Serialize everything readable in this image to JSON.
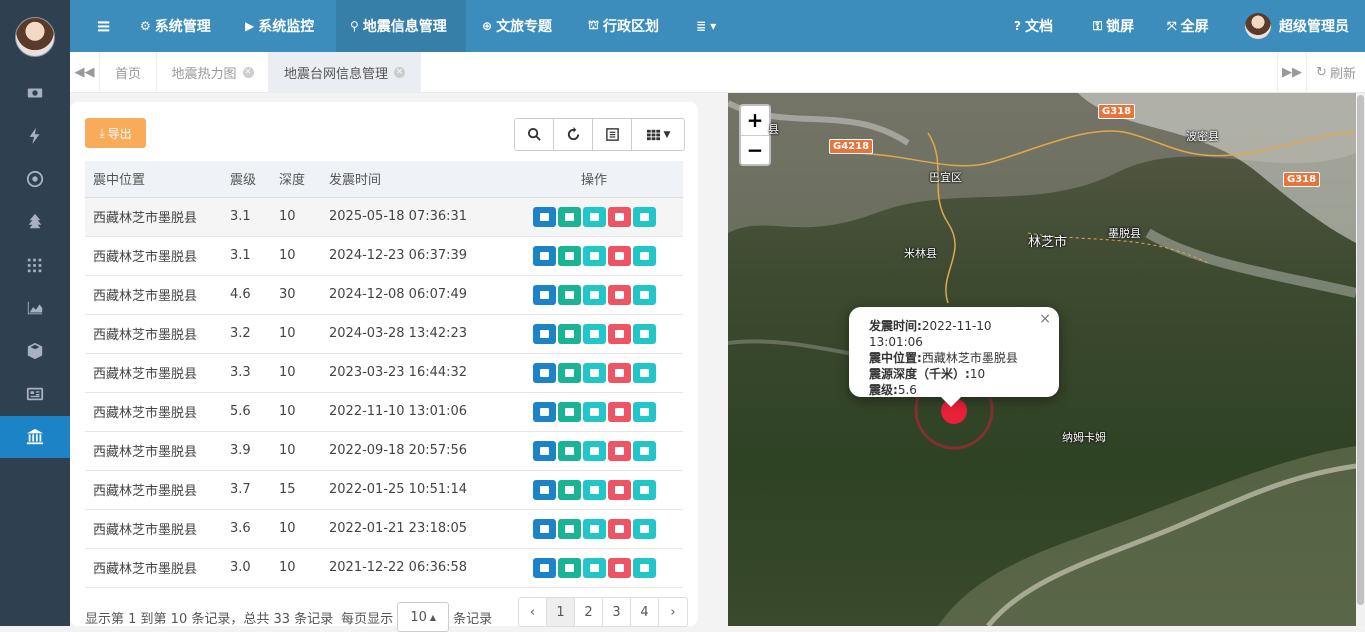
{
  "nav": {
    "items": [
      {
        "icon": "gear-icon",
        "glyph": "⚙",
        "label": "系统管理"
      },
      {
        "icon": "video-camera-icon",
        "glyph": "▶",
        "label": "系统监控"
      },
      {
        "icon": "map-marker-icon",
        "glyph": "⚲",
        "label": "地震信息管理"
      },
      {
        "icon": "globe-icon",
        "glyph": "⊕",
        "label": "文旅专题"
      },
      {
        "icon": "bank-icon",
        "glyph": "⛫",
        "label": "行政区划"
      },
      {
        "icon": "list-icon",
        "glyph": "≣ ▾",
        "label": ""
      }
    ],
    "docs": "文档",
    "lock": "锁屏",
    "fullscreen": "全屏",
    "user": "超级管理员",
    "menu_toggle": "≡"
  },
  "tabs": {
    "items": [
      {
        "label": "首页",
        "closable": false
      },
      {
        "label": "地震热力图",
        "closable": true
      },
      {
        "label": "地震台网信息管理",
        "closable": true
      }
    ],
    "refresh": "刷新"
  },
  "sidebar": {
    "icons": [
      "money-icon",
      "bolt-icon",
      "dot-circle-icon",
      "tree-icon",
      "grid-icon",
      "area-chart-icon",
      "cube-icon",
      "newspaper-icon",
      "bank-icon"
    ]
  },
  "toolbar": {
    "export_label": "导出"
  },
  "table": {
    "headers": [
      "震中位置",
      "震级",
      "深度",
      "发震时间",
      "操作"
    ],
    "rows": [
      [
        "西藏林芝市墨脱县",
        "3.1",
        "10",
        "2025-05-18 07:36:31"
      ],
      [
        "西藏林芝市墨脱县",
        "3.1",
        "10",
        "2024-12-23 06:37:39"
      ],
      [
        "西藏林芝市墨脱县",
        "4.6",
        "30",
        "2024-12-08 06:07:49"
      ],
      [
        "西藏林芝市墨脱县",
        "3.2",
        "10",
        "2024-03-28 13:42:23"
      ],
      [
        "西藏林芝市墨脱县",
        "3.3",
        "10",
        "2023-03-23 16:44:32"
      ],
      [
        "西藏林芝市墨脱县",
        "5.6",
        "10",
        "2022-11-10 13:01:06"
      ],
      [
        "西藏林芝市墨脱县",
        "3.9",
        "10",
        "2022-09-18 20:57:56"
      ],
      [
        "西藏林芝市墨脱县",
        "3.7",
        "15",
        "2022-01-25 10:51:14"
      ],
      [
        "西藏林芝市墨脱县",
        "3.6",
        "10",
        "2022-01-21 23:18:05"
      ],
      [
        "西藏林芝市墨脱县",
        "3.0",
        "10",
        "2021-12-22 06:36:58"
      ]
    ],
    "highlighted_row": 0
  },
  "footer": {
    "summary": "显示第 1 到第 10 条记录，总共 33 条记录",
    "per_page_prefix": "每页显示",
    "per_page_value": "10",
    "per_page_suffix": "条记录",
    "pages": [
      "‹",
      "1",
      "2",
      "3",
      "4",
      "›"
    ],
    "current_page": "1"
  },
  "map": {
    "zoom_in": "+",
    "zoom_out": "−",
    "places": [
      "巴宜区",
      "米林县",
      "林芝市",
      "墨脱县",
      "波密县",
      "纳姆卡姆",
      "县"
    ],
    "roads": [
      "G4218",
      "G318",
      "G318"
    ],
    "popup": {
      "time_label": "发震时间:",
      "time_value": "2022-11-10 13:01:06",
      "location_label": "震中位置:",
      "location_value": "西藏林芝市墨脱县",
      "depth_label": "震源深度（千米）:",
      "depth_value": "10",
      "magnitude_label": "震级:",
      "magnitude_value": "5.6",
      "close": "×"
    },
    "marker_color": "#e8203a"
  }
}
